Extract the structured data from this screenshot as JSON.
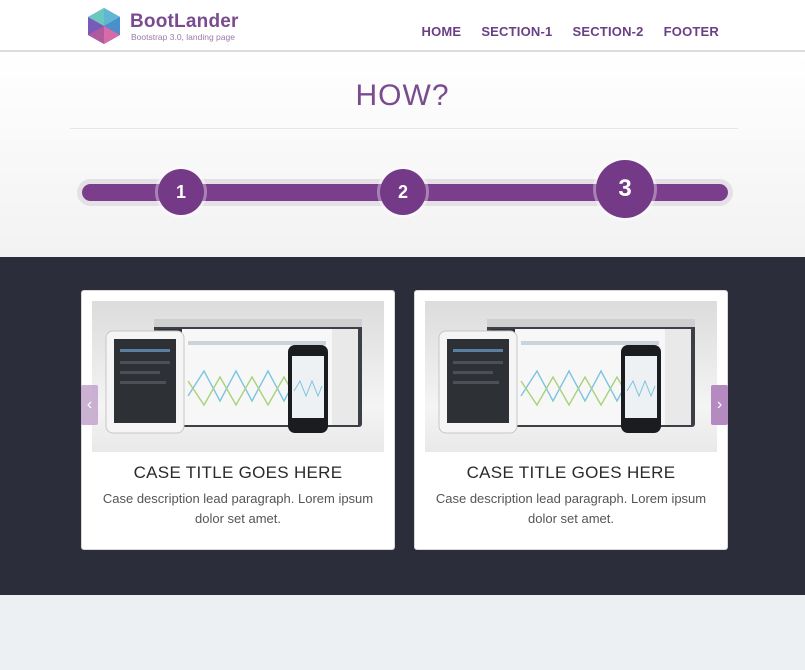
{
  "brand": {
    "name": "BootLander",
    "tagline": "Bootstrap 3.0, landing page"
  },
  "nav": {
    "items": [
      "HOME",
      "SECTION-1",
      "SECTION-2",
      "FOOTER"
    ]
  },
  "how": {
    "title": "HOW?",
    "steps": [
      "1",
      "2",
      "3"
    ]
  },
  "cases": {
    "items": [
      {
        "title": "CASE TITLE GOES HERE",
        "description": "Case description lead paragraph. Lorem ipsum dolor set amet."
      },
      {
        "title": "CASE TITLE GOES HERE",
        "description": "Case description lead paragraph. Lorem ipsum dolor set amet."
      }
    ],
    "prev_icon": "‹",
    "next_icon": "›"
  },
  "colors": {
    "accent": "#7b3e8d",
    "dark_band": "#2b2d3b",
    "footer_band": "#edf0f2"
  }
}
